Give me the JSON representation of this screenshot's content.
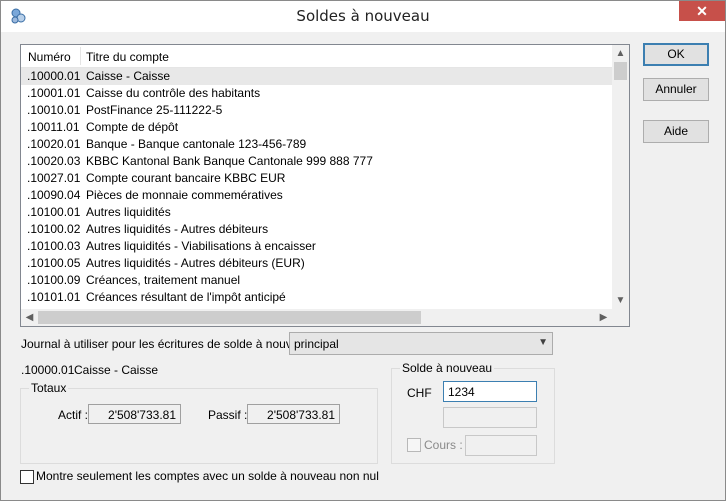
{
  "window": {
    "title": "Soldes à nouveau",
    "close_glyph": "✕"
  },
  "list": {
    "headers": {
      "number": "Numéro",
      "title": "Titre du compte"
    },
    "rows": [
      {
        "number": ".10000.01",
        "title": "Caisse - Caisse"
      },
      {
        "number": ".10001.01",
        "title": "Caisse du contrôle des habitants"
      },
      {
        "number": ".10010.01",
        "title": "PostFinance 25-111222-5"
      },
      {
        "number": ".10011.01",
        "title": "Compte de dépôt"
      },
      {
        "number": ".10020.01",
        "title": "Banque - Banque cantonale 123-456-789"
      },
      {
        "number": ".10020.03",
        "title": "KBBC Kantonal Bank Banque Cantonale  999 888 777"
      },
      {
        "number": ".10027.01",
        "title": "Compte courant bancaire KBBC EUR"
      },
      {
        "number": ".10090.04",
        "title": "Pièces de monnaie commemératives"
      },
      {
        "number": ".10100.01",
        "title": "Autres liquidités"
      },
      {
        "number": ".10100.02",
        "title": "Autres liquidités - Autres débiteurs"
      },
      {
        "number": ".10100.03",
        "title": "Autres liquidités - Viabilisations à encaisser"
      },
      {
        "number": ".10100.05",
        "title": "Autres liquidités - Autres débiteurs (EUR)"
      },
      {
        "number": ".10100.09",
        "title": "Créances, traitement manuel"
      },
      {
        "number": ".10101.01",
        "title": "Créances résultant de l'impôt anticipé"
      }
    ]
  },
  "buttons": {
    "ok": "OK",
    "cancel": "Annuler",
    "help": "Aide"
  },
  "journal": {
    "label": "Journal à utiliser pour les écritures de solde à nouveau :",
    "value": "principal"
  },
  "selected_account": {
    "number": ".10000.01",
    "name": "Caisse - Caisse"
  },
  "totals": {
    "group_label": "Totaux",
    "actif_label": "Actif :",
    "actif_value": "2'508'733.81",
    "passif_label": "Passif :",
    "passif_value": "2'508'733.81"
  },
  "balance": {
    "group_label": "Solde à nouveau",
    "currency_label": "CHF",
    "value": "1234",
    "second_value": "",
    "rate_label": "Cours :",
    "rate_value": ""
  },
  "filter": {
    "label": "Montre seulement les comptes avec un solde  à nouveau non nul"
  },
  "colors": {
    "selection": "#e8e8e8",
    "focus_border": "#3c7fb1",
    "close_red": "#c7504a"
  },
  "icons": {
    "app": "app-icon",
    "up": "scroll-up-arrow-icon",
    "down": "scroll-down-arrow-icon"
  }
}
